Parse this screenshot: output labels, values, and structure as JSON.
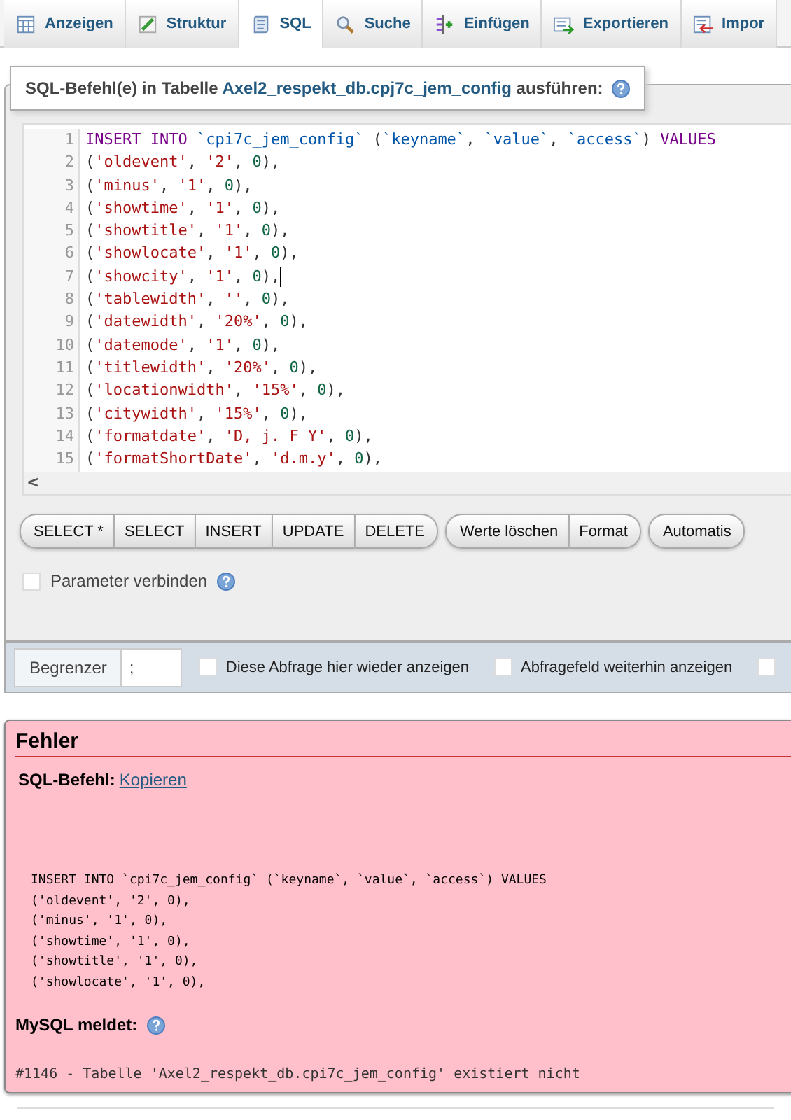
{
  "tabs": [
    {
      "label": "Anzeigen",
      "selected": false
    },
    {
      "label": "Struktur",
      "selected": false
    },
    {
      "label": "SQL",
      "selected": true
    },
    {
      "label": "Suche",
      "selected": false
    },
    {
      "label": "Einfügen",
      "selected": false
    },
    {
      "label": "Exportieren",
      "selected": false
    },
    {
      "label": "Impor",
      "selected": false
    }
  ],
  "query_panel": {
    "legend_prefix": "SQL-Befehl(e) in Tabelle",
    "legend_table": "Axel2_respekt_db.cpj7c_jem_config",
    "legend_suffix": "ausführen:",
    "editor_lines": [
      {
        "number": "1",
        "cursor": false,
        "tokens": [
          {
            "kind": "keyword",
            "text": "INSERT INTO"
          },
          {
            "kind": "identifier",
            "text": " `cpi7c_jem_config`"
          },
          {
            "kind": "plain",
            "text": " ("
          },
          {
            "kind": "identifier",
            "text": "`keyname`"
          },
          {
            "kind": "plain",
            "text": ", "
          },
          {
            "kind": "identifier",
            "text": "`value`"
          },
          {
            "kind": "plain",
            "text": ", "
          },
          {
            "kind": "identifier",
            "text": "`access`"
          },
          {
            "kind": "plain",
            "text": ") "
          },
          {
            "kind": "keyword",
            "text": "VALUES"
          }
        ]
      },
      {
        "number": "2",
        "cursor": false,
        "tokens": [
          {
            "kind": "plain",
            "text": "("
          },
          {
            "kind": "string",
            "text": "'oldevent'"
          },
          {
            "kind": "plain",
            "text": ", "
          },
          {
            "kind": "string",
            "text": "'2'"
          },
          {
            "kind": "plain",
            "text": ", "
          },
          {
            "kind": "number",
            "text": "0"
          },
          {
            "kind": "plain",
            "text": "),"
          }
        ]
      },
      {
        "number": "3",
        "cursor": false,
        "tokens": [
          {
            "kind": "plain",
            "text": "("
          },
          {
            "kind": "string",
            "text": "'minus'"
          },
          {
            "kind": "plain",
            "text": ", "
          },
          {
            "kind": "string",
            "text": "'1'"
          },
          {
            "kind": "plain",
            "text": ", "
          },
          {
            "kind": "number",
            "text": "0"
          },
          {
            "kind": "plain",
            "text": "),"
          }
        ]
      },
      {
        "number": "4",
        "cursor": false,
        "tokens": [
          {
            "kind": "plain",
            "text": "("
          },
          {
            "kind": "string",
            "text": "'showtime'"
          },
          {
            "kind": "plain",
            "text": ", "
          },
          {
            "kind": "string",
            "text": "'1'"
          },
          {
            "kind": "plain",
            "text": ", "
          },
          {
            "kind": "number",
            "text": "0"
          },
          {
            "kind": "plain",
            "text": "),"
          }
        ]
      },
      {
        "number": "5",
        "cursor": false,
        "tokens": [
          {
            "kind": "plain",
            "text": "("
          },
          {
            "kind": "string",
            "text": "'showtitle'"
          },
          {
            "kind": "plain",
            "text": ", "
          },
          {
            "kind": "string",
            "text": "'1'"
          },
          {
            "kind": "plain",
            "text": ", "
          },
          {
            "kind": "number",
            "text": "0"
          },
          {
            "kind": "plain",
            "text": "),"
          }
        ]
      },
      {
        "number": "6",
        "cursor": false,
        "tokens": [
          {
            "kind": "plain",
            "text": "("
          },
          {
            "kind": "string",
            "text": "'showlocate'"
          },
          {
            "kind": "plain",
            "text": ", "
          },
          {
            "kind": "string",
            "text": "'1'"
          },
          {
            "kind": "plain",
            "text": ", "
          },
          {
            "kind": "number",
            "text": "0"
          },
          {
            "kind": "plain",
            "text": "),"
          }
        ]
      },
      {
        "number": "7",
        "cursor": true,
        "tokens": [
          {
            "kind": "plain",
            "text": "("
          },
          {
            "kind": "string",
            "text": "'showcity'"
          },
          {
            "kind": "plain",
            "text": ", "
          },
          {
            "kind": "string",
            "text": "'1'"
          },
          {
            "kind": "plain",
            "text": ", "
          },
          {
            "kind": "number",
            "text": "0"
          },
          {
            "kind": "plain",
            "text": "),"
          }
        ]
      },
      {
        "number": "8",
        "cursor": false,
        "tokens": [
          {
            "kind": "plain",
            "text": "("
          },
          {
            "kind": "string",
            "text": "'tablewidth'"
          },
          {
            "kind": "plain",
            "text": ", "
          },
          {
            "kind": "string",
            "text": "''"
          },
          {
            "kind": "plain",
            "text": ", "
          },
          {
            "kind": "number",
            "text": "0"
          },
          {
            "kind": "plain",
            "text": "),"
          }
        ]
      },
      {
        "number": "9",
        "cursor": false,
        "tokens": [
          {
            "kind": "plain",
            "text": "("
          },
          {
            "kind": "string",
            "text": "'datewidth'"
          },
          {
            "kind": "plain",
            "text": ", "
          },
          {
            "kind": "string",
            "text": "'20%'"
          },
          {
            "kind": "plain",
            "text": ", "
          },
          {
            "kind": "number",
            "text": "0"
          },
          {
            "kind": "plain",
            "text": "),"
          }
        ]
      },
      {
        "number": "10",
        "cursor": false,
        "tokens": [
          {
            "kind": "plain",
            "text": "("
          },
          {
            "kind": "string",
            "text": "'datemode'"
          },
          {
            "kind": "plain",
            "text": ", "
          },
          {
            "kind": "string",
            "text": "'1'"
          },
          {
            "kind": "plain",
            "text": ", "
          },
          {
            "kind": "number",
            "text": "0"
          },
          {
            "kind": "plain",
            "text": "),"
          }
        ]
      },
      {
        "number": "11",
        "cursor": false,
        "tokens": [
          {
            "kind": "plain",
            "text": "("
          },
          {
            "kind": "string",
            "text": "'titlewidth'"
          },
          {
            "kind": "plain",
            "text": ", "
          },
          {
            "kind": "string",
            "text": "'20%'"
          },
          {
            "kind": "plain",
            "text": ", "
          },
          {
            "kind": "number",
            "text": "0"
          },
          {
            "kind": "plain",
            "text": "),"
          }
        ]
      },
      {
        "number": "12",
        "cursor": false,
        "tokens": [
          {
            "kind": "plain",
            "text": "("
          },
          {
            "kind": "string",
            "text": "'locationwidth'"
          },
          {
            "kind": "plain",
            "text": ", "
          },
          {
            "kind": "string",
            "text": "'15%'"
          },
          {
            "kind": "plain",
            "text": ", "
          },
          {
            "kind": "number",
            "text": "0"
          },
          {
            "kind": "plain",
            "text": "),"
          }
        ]
      },
      {
        "number": "13",
        "cursor": false,
        "tokens": [
          {
            "kind": "plain",
            "text": "("
          },
          {
            "kind": "string",
            "text": "'citywidth'"
          },
          {
            "kind": "plain",
            "text": ", "
          },
          {
            "kind": "string",
            "text": "'15%'"
          },
          {
            "kind": "plain",
            "text": ", "
          },
          {
            "kind": "number",
            "text": "0"
          },
          {
            "kind": "plain",
            "text": "),"
          }
        ]
      },
      {
        "number": "14",
        "cursor": false,
        "tokens": [
          {
            "kind": "plain",
            "text": "("
          },
          {
            "kind": "string",
            "text": "'formatdate'"
          },
          {
            "kind": "plain",
            "text": ", "
          },
          {
            "kind": "string",
            "text": "'D, j. F Y'"
          },
          {
            "kind": "plain",
            "text": ", "
          },
          {
            "kind": "number",
            "text": "0"
          },
          {
            "kind": "plain",
            "text": "),"
          }
        ]
      },
      {
        "number": "15",
        "cursor": false,
        "tokens": [
          {
            "kind": "plain",
            "text": "("
          },
          {
            "kind": "string",
            "text": "'formatShortDate'"
          },
          {
            "kind": "plain",
            "text": ", "
          },
          {
            "kind": "string",
            "text": "'d.m.y'"
          },
          {
            "kind": "plain",
            "text": ", "
          },
          {
            "kind": "number",
            "text": "0"
          },
          {
            "kind": "plain",
            "text": "),"
          }
        ]
      }
    ],
    "scroll_left": "<",
    "button_groups": [
      [
        "SELECT *",
        "SELECT",
        "INSERT",
        "UPDATE",
        "DELETE"
      ],
      [
        "Werte löschen",
        "Format"
      ],
      [
        "Automatis"
      ]
    ],
    "bind_parameters": {
      "label": "Parameter verbinden",
      "checked": false
    }
  },
  "options_bar": {
    "delimiter_label": "Begrenzer",
    "delimiter_value": ";",
    "checkboxes": [
      {
        "label": "Diese Abfrage hier wieder anzeigen",
        "checked": false
      },
      {
        "label": "Abfragefeld weiterhin anzeigen",
        "checked": false
      },
      {
        "checked": false
      }
    ]
  },
  "error": {
    "title": "Fehler",
    "sql_label": "SQL-Befehl:",
    "copy_link": "Kopieren",
    "sql_lines": [
      "INSERT INTO `cpi7c_jem_config` (`keyname`, `value`, `access`) VALUES",
      "('oldevent', '2', 0),",
      "('minus', '1', 0),",
      "('showtime', '1', 0),",
      "('showtitle', '1', 0),",
      "('showlocate', '1', 0),"
    ],
    "server_label": "MySQL meldet:",
    "message": "#1146 - Tabelle 'Axel2_respekt_db.cpi7c_jem_config' existiert nicht"
  }
}
